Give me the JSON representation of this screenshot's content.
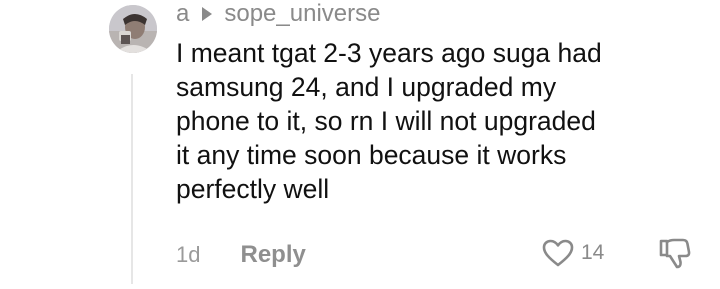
{
  "comment": {
    "author": "a",
    "reply_to": "sope_universe",
    "text": "I meant tgat 2-3 years ago suga had\nsamsung 24, and I upgraded my\nphone to it, so rn I will not upgraded\nit any time soon because it works\nperfectly well",
    "timestamp": "1d",
    "reply_label": "Reply",
    "like_count": "14"
  },
  "icons": {
    "reply_arrow": "caret-right-icon",
    "like": "heart-outline-icon",
    "dislike": "thumbs-down-outline-icon",
    "avatar": "user-avatar"
  },
  "colors": {
    "text": "#111111",
    "muted": "#8a8a8a",
    "thread_line": "#e6e6e6"
  }
}
